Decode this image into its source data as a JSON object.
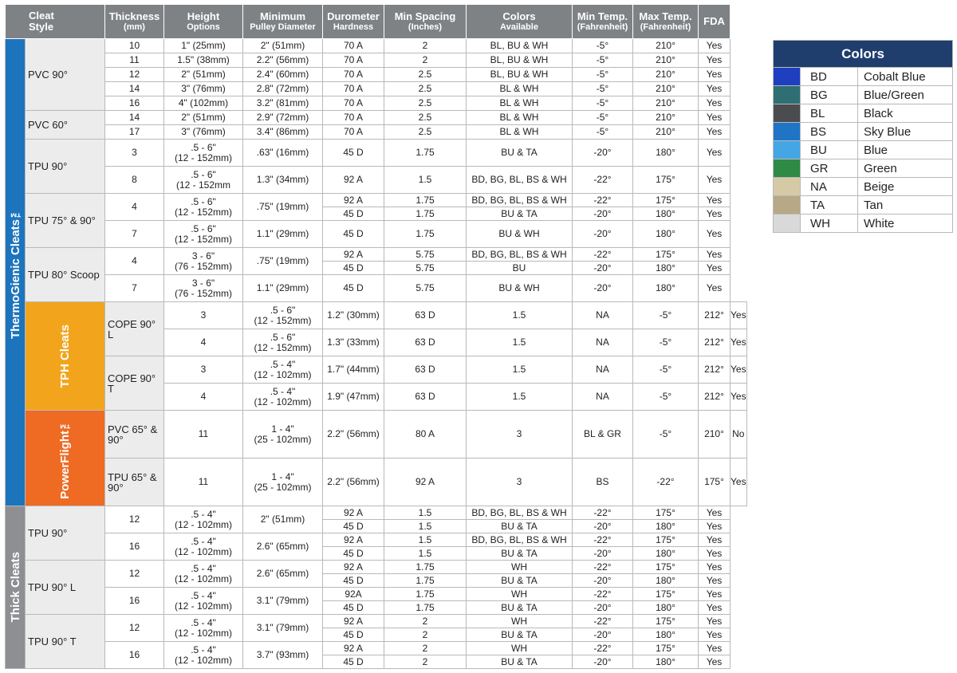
{
  "headers": {
    "style": [
      "Cleat",
      "Style"
    ],
    "thickness": [
      "Thickness",
      "(mm)"
    ],
    "height": [
      "Height",
      "Options"
    ],
    "pulley": [
      "Minimum",
      "Pulley Diameter"
    ],
    "durometer": [
      "Durometer",
      "Hardness"
    ],
    "spacing": [
      "Min Spacing",
      "(Inches)"
    ],
    "colors": [
      "Colors",
      "Available"
    ],
    "min_temp": [
      "Min Temp.",
      "(Fahrenheit)"
    ],
    "max_temp": [
      "Max Temp.",
      "(Fahrenheit)"
    ],
    "fda": "FDA"
  },
  "groups": [
    {
      "name": "ThermoGienic Cleats™",
      "color": "#1c74bd"
    },
    {
      "name": "TPH Cleats",
      "color": "#f2a51c"
    },
    {
      "name": "PowerFlight™",
      "color": "#ef6a23"
    },
    {
      "name": "Thick Cleats",
      "color": "#8d8f92"
    }
  ],
  "styles": {
    "pvc90": "PVC 90°",
    "pvc60": "PVC 60°",
    "tpu90": "TPU 90°",
    "tpu7590": "TPU 75° & 90°",
    "tpu80": "TPU 80° Scoop",
    "cope90l": "COPE 90° L",
    "cope90t": "COPE 90° T",
    "pvc6590": "PVC 65° & 90°",
    "tpu6590": "TPU 65° & 90°",
    "thick_tpu90": "TPU 90°",
    "thick_tpu90l": "TPU 90° L",
    "thick_tpu90t": "TPU 90° T"
  },
  "rows": [
    [
      "10",
      "1\" (25mm)",
      "2\" (51mm)",
      "70 A",
      "2",
      "BL, BU & WH",
      "-5°",
      "210°",
      "Yes"
    ],
    [
      "11",
      "1.5\" (38mm)",
      "2.2\" (56mm)",
      "70 A",
      "2",
      "BL, BU & WH",
      "-5°",
      "210°",
      "Yes"
    ],
    [
      "12",
      "2\" (51mm)",
      "2.4\" (60mm)",
      "70 A",
      "2.5",
      "BL, BU & WH",
      "-5°",
      "210°",
      "Yes"
    ],
    [
      "14",
      "3\" (76mm)",
      "2.8\" (72mm)",
      "70 A",
      "2.5",
      "BL & WH",
      "-5°",
      "210°",
      "Yes"
    ],
    [
      "16",
      "4\" (102mm)",
      "3.2\" (81mm)",
      "70 A",
      "2.5",
      "BL & WH",
      "-5°",
      "210°",
      "Yes"
    ],
    [
      "14",
      "2\" (51mm)",
      "2.9\" (72mm)",
      "70 A",
      "2.5",
      "BL & WH",
      "-5°",
      "210°",
      "Yes"
    ],
    [
      "17",
      "3\" (76mm)",
      "3.4\" (86mm)",
      "70 A",
      "2.5",
      "BL & WH",
      "-5°",
      "210°",
      "Yes"
    ],
    [
      "3",
      [
        ".5 - 6\"",
        "(12 - 152mm)"
      ],
      ".63\" (16mm)",
      "45 D",
      "1.75",
      "BU & TA",
      "-20°",
      "180°",
      "Yes"
    ],
    [
      "8",
      [
        ".5 - 6\"",
        "(12 - 152mm"
      ],
      "1.3\" (34mm)",
      "92 A",
      "1.5",
      "BD, BG, BL, BS & WH",
      "-22°",
      "175°",
      "Yes"
    ],
    [
      "92 A",
      "1.75",
      "BD, BG, BL, BS & WH",
      "-22°",
      "175°",
      "Yes"
    ],
    [
      "45 D",
      "1.75",
      "BU & TA",
      "-20°",
      "180°",
      "Yes"
    ],
    [
      "7",
      [
        ".5 - 6\"",
        "(12 - 152mm)"
      ],
      "1.1\" (29mm)",
      "45 D",
      "1.75",
      "BU & WH",
      "-20°",
      "180°",
      "Yes"
    ],
    [
      "92 A",
      "5.75",
      "BD, BG, BL, BS & WH",
      "-22°",
      "175°",
      "Yes"
    ],
    [
      "45 D",
      "5.75",
      "BU",
      "-20°",
      "180°",
      "Yes"
    ],
    [
      "7",
      [
        "3 - 6\"",
        "(76 - 152mm)"
      ],
      "1.1\" (29mm)",
      "45 D",
      "5.75",
      "BU & WH",
      "-20°",
      "180°",
      "Yes"
    ],
    [
      "3",
      [
        ".5 - 6\"",
        "(12 - 152mm)"
      ],
      "1.2\" (30mm)",
      "63 D",
      "1.5",
      "NA",
      "-5°",
      "212°",
      "Yes"
    ],
    [
      "4",
      [
        ".5 - 6\"",
        "(12 - 152mm)"
      ],
      "1.3\" (33mm)",
      "63 D",
      "1.5",
      "NA",
      "-5°",
      "212°",
      "Yes"
    ],
    [
      "3",
      [
        ".5 - 4\"",
        "(12 - 102mm)"
      ],
      "1.7\" (44mm)",
      "63 D",
      "1.5",
      "NA",
      "-5°",
      "212°",
      "Yes"
    ],
    [
      "4",
      [
        ".5 - 4\"",
        "(12 - 102mm)"
      ],
      "1.9\" (47mm)",
      "63 D",
      "1.5",
      "NA",
      "-5°",
      "212°",
      "Yes"
    ],
    [
      "11",
      [
        "1 - 4\"",
        "(25 - 102mm)"
      ],
      "2.2\" (56mm)",
      "80 A",
      "3",
      "BL & GR",
      "-5°",
      "210°",
      "No"
    ],
    [
      "11",
      [
        "1 - 4\"",
        "(25 - 102mm)"
      ],
      "2.2\" (56mm)",
      "92 A",
      "3",
      "BS",
      "-22°",
      "175°",
      "Yes"
    ],
    [
      "92 A",
      "1.5",
      "BD, BG, BL, BS & WH",
      "-22°",
      "175°",
      "Yes"
    ],
    [
      "45 D",
      "1.5",
      "BU & TA",
      "-20°",
      "180°",
      "Yes"
    ],
    [
      "92 A",
      "1.5",
      "BD, BG, BL, BS & WH",
      "-22°",
      "175°",
      "Yes"
    ],
    [
      "45 D",
      "1.5",
      "BU & TA",
      "-20°",
      "180°",
      "Yes"
    ],
    [
      "92 A",
      "1.75",
      "WH",
      "-22°",
      "175°",
      "Yes"
    ],
    [
      "45 D",
      "1.75",
      "BU & TA",
      "-20°",
      "180°",
      "Yes"
    ],
    [
      "92A",
      "1.75",
      "WH",
      "-22°",
      "175°",
      "Yes"
    ],
    [
      "45 D",
      "1.75",
      "BU & TA",
      "-20°",
      "180°",
      "Yes"
    ],
    [
      "92 A",
      "2",
      "WH",
      "-22°",
      "175°",
      "Yes"
    ],
    [
      "45 D",
      "2",
      "BU & TA",
      "-20°",
      "180°",
      "Yes"
    ],
    [
      "92 A",
      "2",
      "WH",
      "-22°",
      "175°",
      "Yes"
    ],
    [
      "45 D",
      "2",
      "BU & TA",
      "-20°",
      "180°",
      "Yes"
    ]
  ],
  "merged": {
    "tpu7590_4": [
      "4",
      [
        ".5 - 6\"",
        "(12 - 152mm)"
      ],
      ".75\" (19mm)"
    ],
    "tpu80_4": [
      "4",
      [
        "3 - 6\"",
        "(76 - 152mm)"
      ],
      ".75\" (19mm)"
    ],
    "thick90_12": [
      "12",
      [
        ".5 - 4\"",
        "(12 - 102mm)"
      ],
      "2\" (51mm)"
    ],
    "thick90_16": [
      "16",
      [
        ".5 - 4\"",
        "(12 - 102mm)"
      ],
      "2.6\" (65mm)"
    ],
    "thick90l_12": [
      "12",
      [
        ".5 - 4\"",
        "(12 - 102mm)"
      ],
      "2.6\" (65mm)"
    ],
    "thick90l_16": [
      "16",
      [
        ".5 - 4\"",
        "(12 - 102mm)"
      ],
      "3.1\" (79mm)"
    ],
    "thick90t_12": [
      "12",
      [
        ".5 - 4\"",
        "(12 - 102mm)"
      ],
      "3.1\" (79mm)"
    ],
    "thick90t_16": [
      "16",
      [
        ".5 - 4\"",
        "(12 - 102mm)"
      ],
      "3.7\" (93mm)"
    ]
  },
  "legend": {
    "title": "Colors",
    "items": [
      {
        "code": "BD",
        "name": "Cobalt Blue",
        "color": "#1e3fbf"
      },
      {
        "code": "BG",
        "name": "Blue/Green",
        "color": "#2e6f73"
      },
      {
        "code": "BL",
        "name": "Black",
        "color": "#4b4c50"
      },
      {
        "code": "BS",
        "name": "Sky Blue",
        "color": "#1f74c6"
      },
      {
        "code": "BU",
        "name": "Blue",
        "color": "#44a6e4"
      },
      {
        "code": "GR",
        "name": "Green",
        "color": "#2f8a45"
      },
      {
        "code": "NA",
        "name": "Beige",
        "color": "#d6caa6"
      },
      {
        "code": "TA",
        "name": "Tan",
        "color": "#b7a988"
      },
      {
        "code": "WH",
        "name": "White",
        "color": "#d9d9d9"
      }
    ]
  }
}
